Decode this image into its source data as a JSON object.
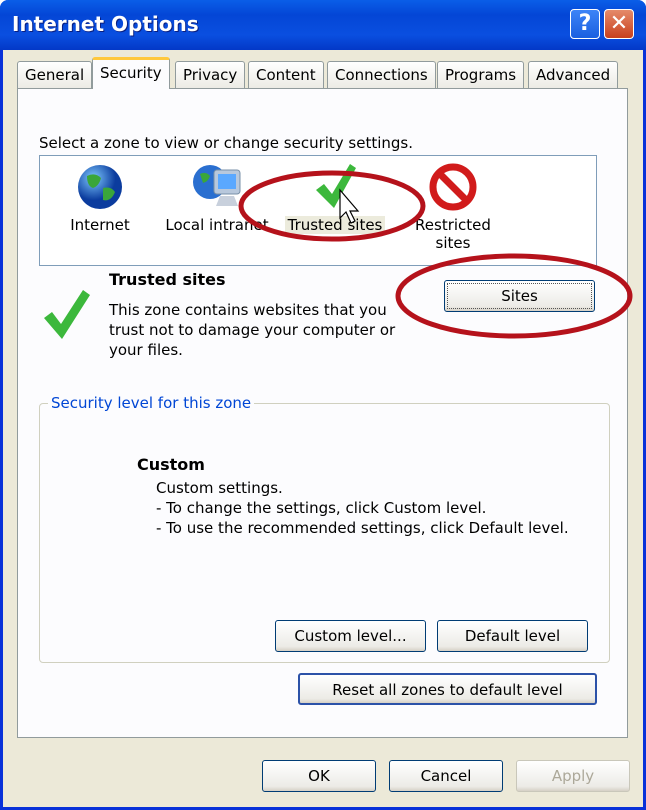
{
  "window": {
    "title": "Internet Options",
    "help_label": "?",
    "close_label": "✕"
  },
  "tabs": [
    {
      "label": "General"
    },
    {
      "label": "Security",
      "active": true
    },
    {
      "label": "Privacy"
    },
    {
      "label": "Content"
    },
    {
      "label": "Connections"
    },
    {
      "label": "Programs"
    },
    {
      "label": "Advanced"
    }
  ],
  "security": {
    "prompt": "Select a zone to view or change security settings.",
    "zones": [
      {
        "label": "Internet",
        "icon": "globe-icon"
      },
      {
        "label": "Local intranet",
        "icon": "intranet-icon"
      },
      {
        "label": "Trusted sites",
        "icon": "checkmark-icon",
        "selected": true
      },
      {
        "label_line1": "Restricted",
        "label_line2": "sites",
        "icon": "restricted-icon"
      }
    ],
    "zone_title": "Trusted sites",
    "zone_desc_1": "This zone contains websites that you",
    "zone_desc_2": "trust not to damage your computer or",
    "zone_desc_3": "your files.",
    "sites_button": "Sites",
    "level_group_label": "Security level for this zone",
    "level_name": "Custom",
    "level_desc_1": "Custom settings.",
    "level_desc_2": "- To change the settings, click Custom level.",
    "level_desc_3": "- To use the recommended settings, click Default level.",
    "custom_level_button": "Custom level...",
    "default_level_button": "Default level",
    "reset_button": "Reset all zones to default level"
  },
  "footer": {
    "ok": "OK",
    "cancel": "Cancel",
    "apply": "Apply"
  },
  "colors": {
    "titlebar": "#0a4fe0",
    "annotation": "#b5121b",
    "dialog": "#ece9d8"
  }
}
